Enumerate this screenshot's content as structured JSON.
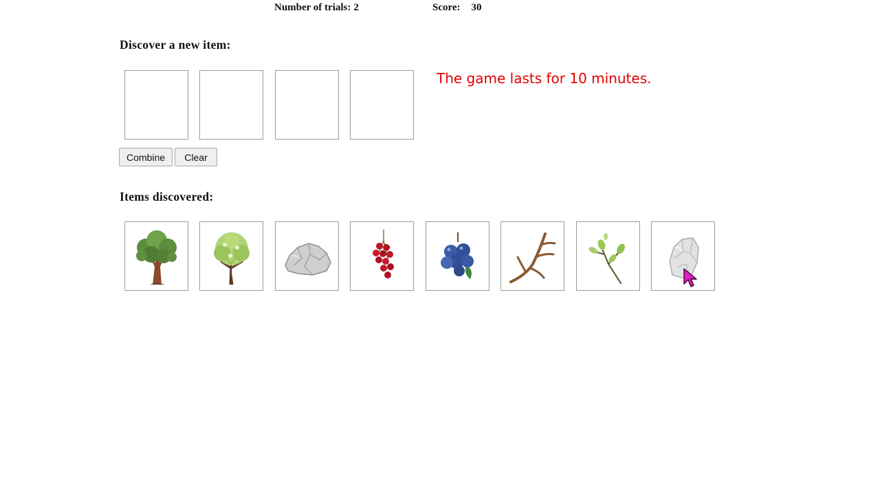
{
  "stats": {
    "trials_label": "Number of trials:",
    "trials_value": "2",
    "score_label": "Score:",
    "score_value": "30"
  },
  "discover": {
    "heading": "Discover a new item:",
    "slots": [
      "",
      "",
      "",
      ""
    ],
    "combine_label": "Combine",
    "clear_label": "Clear"
  },
  "notice": {
    "text": "The game lasts for 10 minutes.",
    "color": "#e00000"
  },
  "discovered": {
    "heading": "Items discovered:",
    "items": [
      {
        "icon": "oak-tree-icon"
      },
      {
        "icon": "leafy-tree-icon"
      },
      {
        "icon": "grey-rock-icon"
      },
      {
        "icon": "red-berries-icon"
      },
      {
        "icon": "blueberries-icon"
      },
      {
        "icon": "antler-icon"
      },
      {
        "icon": "twig-icon"
      },
      {
        "icon": "flint-stone-icon"
      }
    ]
  },
  "cursor": {
    "icon": "mouse-pointer-icon",
    "color": "#e020c0"
  }
}
